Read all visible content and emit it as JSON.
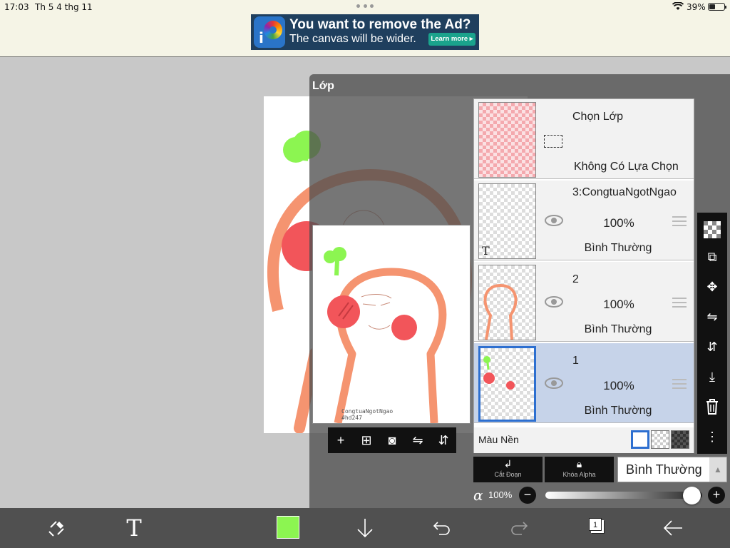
{
  "status_bar": {
    "time": "17:03",
    "date": "Th 5 4 thg 11",
    "battery": "39%"
  },
  "ad": {
    "title": "You want to remove the Ad?",
    "subtitle": "The canvas will be wider.",
    "button": "Learn more ▸"
  },
  "panel": {
    "title": "Lớp"
  },
  "layers": [
    {
      "name": "Chọn Lớp",
      "detail": "Không Có Lựa Chọn"
    },
    {
      "name": "3:CongtuaNgotNgao",
      "opacity": "100%",
      "blend": "Bình Thường"
    },
    {
      "name": "2",
      "opacity": "100%",
      "blend": "Bình Thường"
    },
    {
      "name": "1",
      "opacity": "100%",
      "blend": "Bình Thường"
    }
  ],
  "background_label": "Màu Nền",
  "clip_label": "Cắt Đoạn",
  "alpha_lock_label": "Khóa Alpha",
  "blend_mode": "Bình Thường",
  "alpha": {
    "symbol": "α",
    "value": "100%"
  },
  "watermark": {
    "line1": "CongtuaNgotNgao",
    "line2": "#hd247"
  },
  "current_color": "#8cf551",
  "layer_count": "1",
  "colors": {
    "panel_selected": "#c6d3e9",
    "accent": "#2d6fd0",
    "ad_bg": "#1f3f5e"
  }
}
